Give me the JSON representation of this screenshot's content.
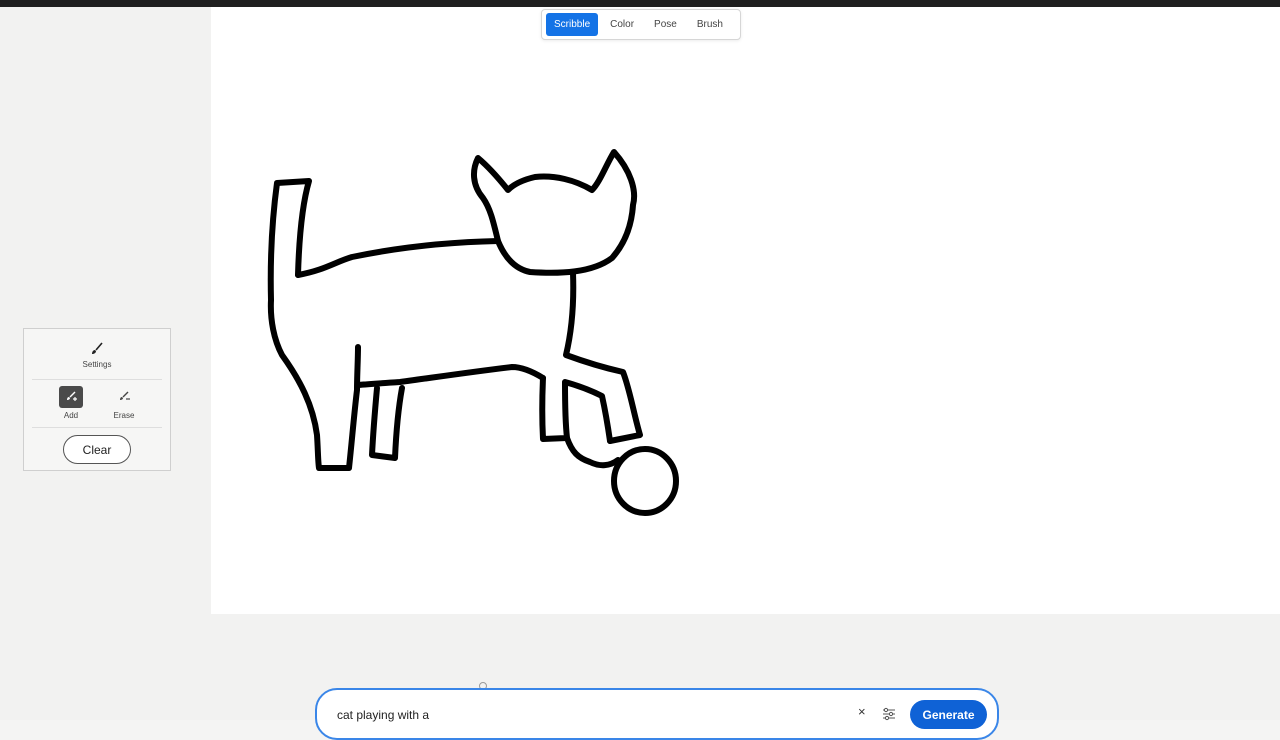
{
  "modes": [
    {
      "label": "Scribble",
      "active": true
    },
    {
      "label": "Color",
      "active": false
    },
    {
      "label": "Pose",
      "active": false
    },
    {
      "label": "Brush",
      "active": false
    }
  ],
  "tool_panel": {
    "settings_label": "Settings",
    "add_label": "Add",
    "erase_label": "Erase",
    "clear_label": "Clear",
    "active_tool": "add"
  },
  "prompt": {
    "value": "cat playing with a",
    "generate_label": "Generate",
    "clear_symbol": "×"
  },
  "colors": {
    "accent": "#1473e6",
    "generate": "#0f62d6",
    "prompt_border": "#3a86e8",
    "canvas": "#ffffff"
  },
  "icons": [
    "brush-icon",
    "brush-add-icon",
    "brush-erase-icon",
    "close-icon",
    "sliders-icon"
  ]
}
